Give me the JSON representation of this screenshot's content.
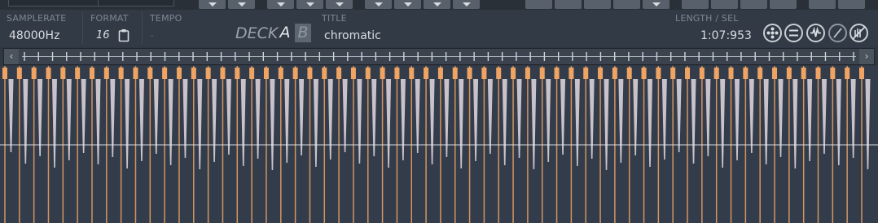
{
  "info": {
    "samplerate_label": "SAMPLERATE",
    "samplerate_value": "48000Hz",
    "format_label": "FORMAT",
    "format_value": "16",
    "tempo_label": "TEMPO",
    "tempo_value": "-",
    "deck_label": "DECK",
    "deck_a": "A",
    "deck_b": "B",
    "title_label": "TITLE",
    "title_value": "chromatic",
    "length_label": "LENGTH / SEL",
    "length_value": "1:07:953"
  },
  "colors": {
    "background": "#2f3741",
    "waveform": "#c9c2ca",
    "marker": "#f0a463",
    "center_line": "#e8ecf0"
  },
  "icons": [
    "reel-icon",
    "menu-icon",
    "waveform-icon",
    "slash-icon",
    "no-speaker-icon"
  ],
  "waveform": {
    "slices": 60
  }
}
